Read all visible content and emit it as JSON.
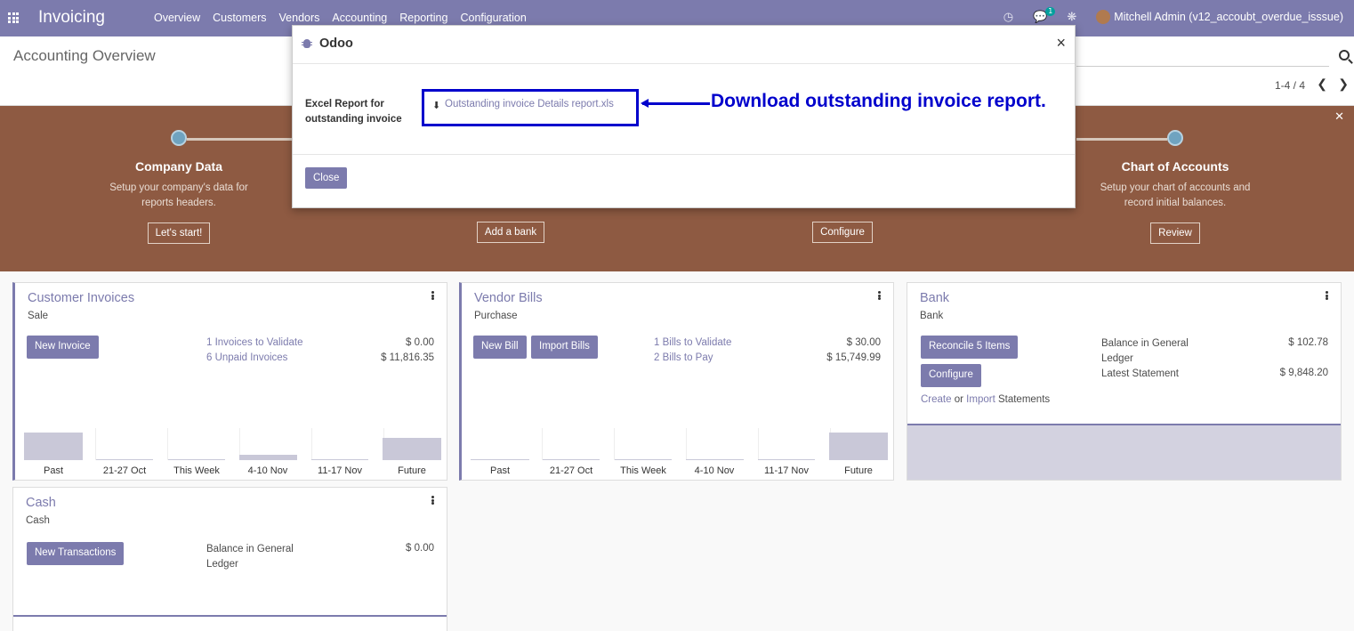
{
  "navbar": {
    "brand": "Invoicing",
    "menu": [
      "Overview",
      "Customers",
      "Vendors",
      "Accounting",
      "Reporting",
      "Configuration"
    ],
    "messages_count": "1",
    "user": "Mitchell Admin (v12_accoubt_overdue_isssue)"
  },
  "control_panel": {
    "title": "Accounting Overview",
    "pager": "1-4 / 4"
  },
  "onboarding": {
    "steps": [
      {
        "title": "Company Data",
        "desc": "Setup your company's data for reports headers.",
        "button": "Let's start!"
      },
      {
        "title": "",
        "desc": "",
        "button": "Add a bank"
      },
      {
        "title": "",
        "desc": "",
        "button": "Configure"
      },
      {
        "title": "Chart of Accounts",
        "desc": "Setup your chart of accounts and record initial balances.",
        "button": "Review"
      }
    ]
  },
  "dashboard": {
    "customer_invoices": {
      "title": "Customer Invoices",
      "subtitle": "Sale",
      "button": "New Invoice",
      "rows": [
        {
          "label": "1 Invoices to Validate",
          "value": "$ 0.00"
        },
        {
          "label": "6 Unpaid Invoices",
          "value": "$ 11,816.35"
        }
      ],
      "chart_ticks": [
        "Past",
        "21-27 Oct",
        "This Week",
        "4-10 Nov",
        "11-17 Nov",
        "Future"
      ]
    },
    "vendor_bills": {
      "title": "Vendor Bills",
      "subtitle": "Purchase",
      "button_new": "New Bill",
      "button_import": "Import Bills",
      "rows": [
        {
          "label": "1 Bills to Validate",
          "value": "$ 30.00"
        },
        {
          "label": "2 Bills to Pay",
          "value": "$ 15,749.99"
        }
      ],
      "chart_ticks": [
        "Past",
        "21-27 Oct",
        "This Week",
        "4-10 Nov",
        "11-17 Nov",
        "Future"
      ]
    },
    "bank": {
      "title": "Bank",
      "subtitle": "Bank",
      "button_reconcile": "Reconcile 5 Items",
      "button_configure": "Configure",
      "create_link": "Create",
      "or_text": "or",
      "import_link": "Import",
      "statements_text": "Statements",
      "balance_label": "Balance in General Ledger",
      "balance_value": "$ 102.78",
      "statement_label": "Latest Statement",
      "statement_value": "$ 9,848.20"
    },
    "cash": {
      "title": "Cash",
      "subtitle": "Cash",
      "button": "New Transactions",
      "balance_label": "Balance in General Ledger",
      "balance_value": "$ 0.00"
    }
  },
  "modal": {
    "title": "Odoo",
    "field_label": "Excel Report for outstanding invoice",
    "file_link": "Outstanding invoice Details report.xls",
    "close_button": "Close"
  },
  "annotation": {
    "text": "Download outstanding invoice report.",
    "color": "#0000cc"
  },
  "colors": {
    "brand": "#7c7bad",
    "banner": "#8e5a42"
  }
}
